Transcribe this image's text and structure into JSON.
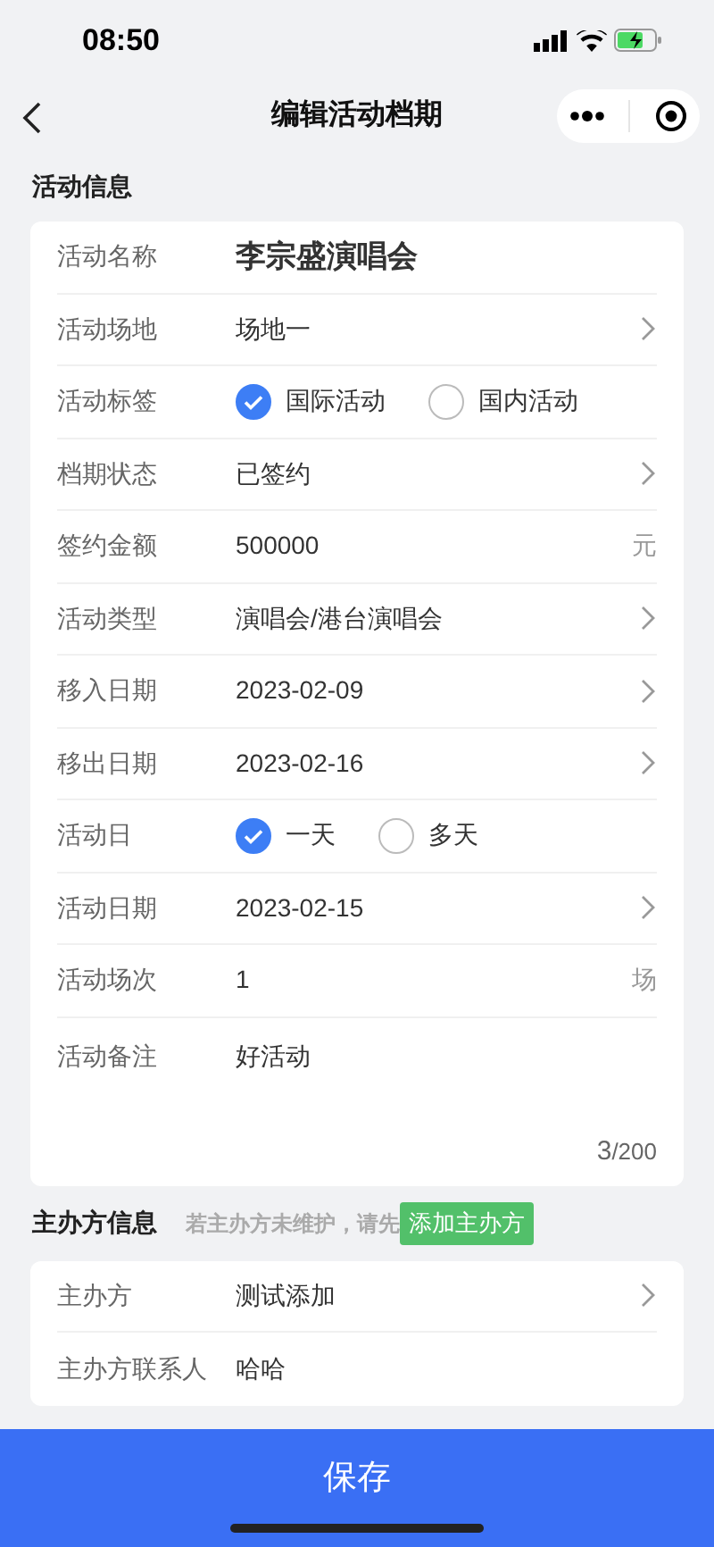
{
  "status_bar": {
    "time": "08:50"
  },
  "nav": {
    "title": "编辑活动档期"
  },
  "activity_section": {
    "title": "活动信息",
    "rows": [
      {
        "kind": "text",
        "label": "活动名称",
        "value": "李宗盛演唱会",
        "emphasis": true
      },
      {
        "kind": "text",
        "label": "活动场地",
        "value": "场地一",
        "arrow": true
      },
      {
        "kind": "radio",
        "label": "活动标签",
        "options": [
          {
            "label": "国际活动",
            "selected": true
          },
          {
            "label": "国内活动",
            "selected": false
          }
        ]
      },
      {
        "kind": "text",
        "label": "档期状态",
        "value": "已签约",
        "arrow": true
      },
      {
        "kind": "text",
        "label": "签约金额",
        "value": "500000",
        "unit": "元"
      },
      {
        "kind": "text",
        "label": "活动类型",
        "value": "演唱会/港台演唱会",
        "arrow": true
      },
      {
        "kind": "text",
        "label": "移入日期",
        "value": "2023-02-09",
        "arrow": true
      },
      {
        "kind": "text",
        "label": "移出日期",
        "value": "2023-02-16",
        "arrow": true
      },
      {
        "kind": "radio",
        "label": "活动日",
        "options": [
          {
            "label": "一天",
            "selected": true
          },
          {
            "label": "多天",
            "selected": false
          }
        ]
      },
      {
        "kind": "text",
        "label": "活动日期",
        "value": "2023-02-15",
        "arrow": true
      },
      {
        "kind": "text",
        "label": "活动场次",
        "value": "1",
        "unit": "场"
      },
      {
        "kind": "textarea",
        "label": "活动备注",
        "value": "好活动",
        "count": "3",
        "limit": "/200"
      }
    ]
  },
  "organizer_section": {
    "title": "主办方信息",
    "hint": "若主办方未维护，请先",
    "add_button": "添加主办方",
    "rows": [
      {
        "kind": "text",
        "label": "主办方",
        "value": "测试添加",
        "arrow": true
      },
      {
        "kind": "text",
        "label": "主办方联系人",
        "value": "哈哈"
      }
    ]
  },
  "save_button": "保存"
}
